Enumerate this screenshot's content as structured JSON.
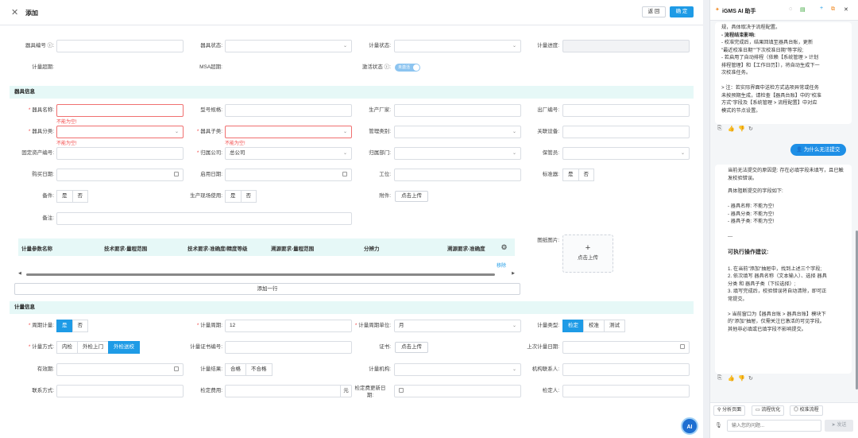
{
  "header": {
    "title": "添加",
    "back_label": "返 回",
    "confirm_label": "确 定"
  },
  "top_fields": {
    "instrument_no": "器具编号",
    "instrument_status": "器具状态:",
    "metrology_status": "计量状态:",
    "metrology_progress": "计量进度:",
    "metrology_overdue": "计量超期:",
    "msa_overdue": "MSA超期:",
    "activation_status": "激活状态",
    "activation_value": "未激活"
  },
  "sections": {
    "instrument_info": "器具信息",
    "metrology_info": "计量信息"
  },
  "instrument": {
    "name": "器具名称:",
    "model": "型号规格:",
    "manufacturer": "生产厂家:",
    "factory_no": "出厂编号:",
    "category": "器具分类:",
    "subcategory": "器具子类:",
    "mgmt_category": "管理类别:",
    "related_equipment": "关联设备:",
    "asset_no": "固定资产编号:",
    "company": "归属公司:",
    "company_value": "总公司",
    "department": "归属部门:",
    "custodian": "保管员:",
    "purchase_date": "购买日期:",
    "enable_date": "启用日期:",
    "position": "工位:",
    "standard": "标准器:",
    "spare": "备件:",
    "onsite_use": "生产现场使用:",
    "attachment": "附件:",
    "upload_label": "点击上传",
    "remark": "备注:",
    "yes": "是",
    "no": "否",
    "error_empty": "不能为空!",
    "drawing": "图纸图片:",
    "upload_plus": "+",
    "add_row": "添加一行",
    "remove": "移除"
  },
  "table_headers": [
    "计量参数名称",
    "技术要求-量程范围",
    "技术要求-准确度/精度等级",
    "溯源要求-量程范围",
    "分辨力",
    "溯源要求-准确度"
  ],
  "metrology": {
    "periodic": "周期计量:",
    "period": "计量周期:",
    "period_value": "12",
    "period_unit": "计量周期单位:",
    "period_unit_value": "月",
    "type": "计量类型:",
    "type_options": [
      "检定",
      "校准",
      "测试"
    ],
    "method": "计量方式:",
    "method_options": [
      "内检",
      "外检上门",
      "外检送校"
    ],
    "cert_no": "计量证书编号:",
    "cert": "证书:",
    "last_date": "上次计量日期:",
    "validity": "有效期:",
    "result": "计量结果:",
    "result_options": [
      "合格",
      "不合格"
    ],
    "org": "计量机构:",
    "org_contact": "机构联系人:",
    "contact_method": "联系方式:",
    "fee": "检定费用:",
    "fee_unit": "元",
    "update_date_1": "检定费更新日",
    "update_date_2": "期:",
    "verifier": "检定人:"
  },
  "assistant": {
    "title": "iGMS AI 助手",
    "msg1": [
      "规，具体取决于流程配置。",
      "- 流程结束影响:",
      "- 校准完成后，结果回填至器具台账，更新",
      "\"最近校准日期\"\"下次校准日期\"等字段;",
      "- 若启用了自动排程（依赖【系统管理 > 计划",
      "排程管理】和【工作日历】），将自动生成下一",
      "次校准任务。",
      "",
      "> 注：若实际界面中送检方式选项异常或任务",
      "未按预期生成，请检查【器具台账】中的\"校准",
      "方式\"字段及【系统管理 > 流程配置】中对应",
      "模式的节点设置。"
    ],
    "user_question": "为什么无法提交",
    "msg2_head": "当前无法提交的原因是: 存在必填字段未填写，且已触发校验错误。",
    "msg2_body": [
      "具体阻断提交的字段如下:",
      "",
      "- 器具名称: 不能为空!",
      "- 器具分类: 不能为空!",
      "- 器具子类: 不能为空!",
      "",
      "---",
      "",
      "可执行操作建议:",
      "",
      "1. 在当前\"添加\"抽屉中，找到上述三个字段;",
      "2. 依次填写 器具名称（文本输入）、选择 器具",
      "分类 和 器具子类（下拉选择）;",
      "3. 填写完成后，校验错误将自动清除，即可正",
      "常提交。",
      "",
      "> 当前窗口为【器具台账 > 器具台账】模块下",
      "的\"添加\"抽屉，仅需关注已激活的可见字段。",
      "其他非必填或已填字段不影响提交。"
    ],
    "quick_actions": [
      "分析页面",
      "流程优化",
      "校准流程"
    ],
    "input_placeholder": "输入您的问题...",
    "send_label": "发送",
    "float_label": "AI"
  }
}
